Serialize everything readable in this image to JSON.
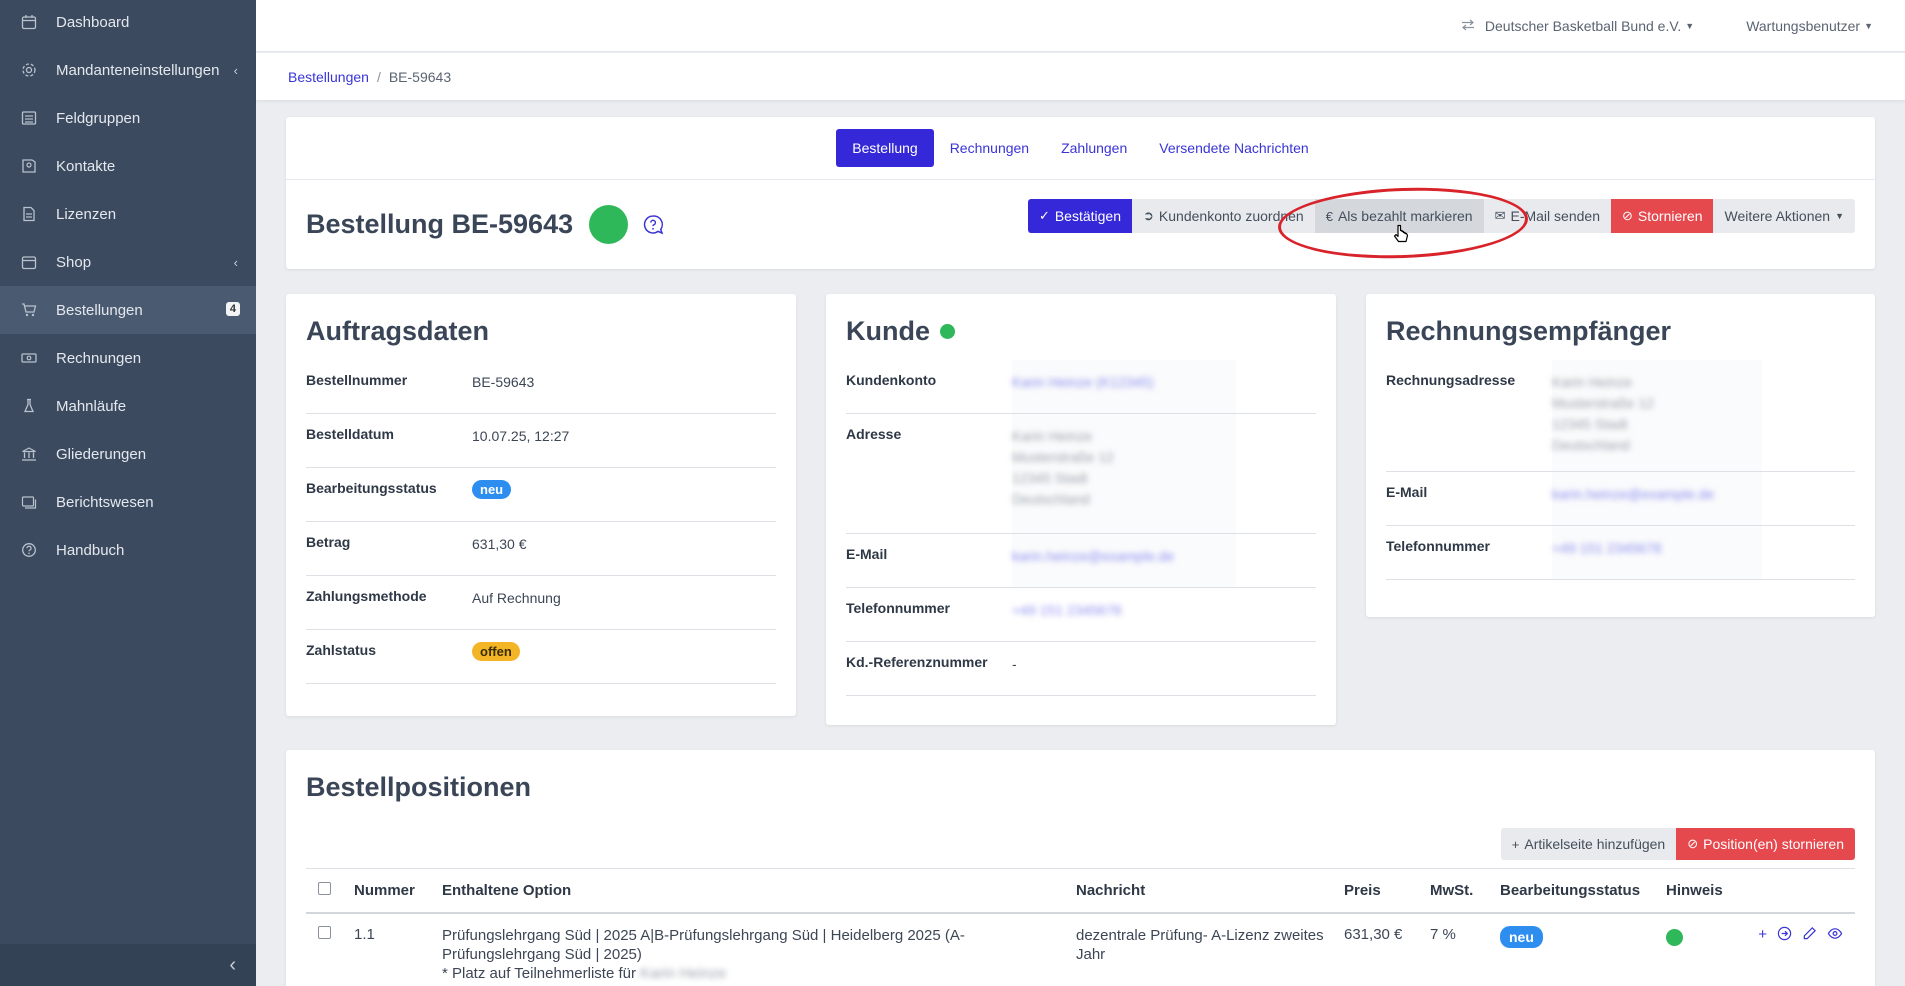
{
  "sidebar": {
    "items": [
      {
        "label": "Dashboard",
        "icon": "calendar-icon"
      },
      {
        "label": "Mandanteneinstellungen",
        "icon": "gear-icon",
        "caret": "‹"
      },
      {
        "label": "Feldgruppen",
        "icon": "list-icon"
      },
      {
        "label": "Kontakte",
        "icon": "book-icon"
      },
      {
        "label": "Lizenzen",
        "icon": "file-icon"
      },
      {
        "label": "Shop",
        "icon": "calendar-icon",
        "caret": "‹"
      },
      {
        "label": "Bestellungen",
        "icon": "cart-icon",
        "badge": "4",
        "active": true
      },
      {
        "label": "Rechnungen",
        "icon": "cash-icon"
      },
      {
        "label": "Mahnläufe",
        "icon": "flask-icon"
      },
      {
        "label": "Gliederungen",
        "icon": "bank-icon"
      },
      {
        "label": "Berichtswesen",
        "icon": "images-icon"
      },
      {
        "label": "Handbuch",
        "icon": "help-icon"
      }
    ],
    "collapse": "‹"
  },
  "topbar": {
    "organization": "Deutscher Basketball Bund e.V.",
    "user": "Wartungsbenutzer"
  },
  "breadcrumb": {
    "parent": "Bestellungen",
    "sep": "/",
    "current": "BE-59643"
  },
  "tabs": [
    "Bestellung",
    "Rechnungen",
    "Zahlungen",
    "Versendete Nachrichten"
  ],
  "order": {
    "title": "Bestellung BE-59643",
    "status_color": "#2fb85a"
  },
  "actions": {
    "confirm": "Bestätigen",
    "assign": "Kundenkonto zuordnen",
    "mark_paid": "Als bezahlt markieren",
    "email": "E-Mail senden",
    "cancel": "Stornieren",
    "more": "Weitere Aktionen"
  },
  "auftragsdaten": {
    "title": "Auftragsdaten",
    "rows": [
      {
        "label": "Bestellnummer",
        "value": "BE-59643"
      },
      {
        "label": "Bestelldatum",
        "value": "10.07.25, 12:27"
      },
      {
        "label": "Bearbeitungsstatus",
        "value": "neu"
      },
      {
        "label": "Betrag",
        "value": "631,30 €"
      },
      {
        "label": "Zahlungsmethode",
        "value": "Auf Rechnung"
      },
      {
        "label": "Zahlstatus",
        "value": "offen"
      }
    ]
  },
  "kunde": {
    "title": "Kunde",
    "rows": [
      {
        "label": "Kundenkonto",
        "value": "Karin Heinze (K12345)"
      },
      {
        "label": "Adresse",
        "lines": [
          "Karin Heinze",
          "Musterstraße 12",
          "12345 Stadt",
          "Deutschland"
        ]
      },
      {
        "label": "E-Mail",
        "value": "karin.heinze@example.de"
      },
      {
        "label": "Telefonnummer",
        "value": "+49 151 2345678"
      },
      {
        "label": "Kd.-Referenznummer",
        "value": "-"
      }
    ]
  },
  "rechnung": {
    "title": "Rechnungsempfänger",
    "rows": [
      {
        "label": "Rechnungsadresse",
        "lines": [
          "Karin Heinze",
          "Musterstraße 12",
          "12345 Stadt",
          "Deutschland"
        ]
      },
      {
        "label": "E-Mail",
        "value": "karin.heinze@example.de"
      },
      {
        "label": "Telefonnummer",
        "value": "+49 151 2345678"
      }
    ]
  },
  "positionen": {
    "title": "Bestellpositionen",
    "add_button": "Artikelseite hinzufügen",
    "cancel_button": "Position(en) stornieren",
    "columns": [
      "Nummer",
      "Enthaltene Option",
      "Nachricht",
      "Preis",
      "MwSt.",
      "Bearbeitungsstatus",
      "Hinweis"
    ],
    "rows": [
      {
        "nummer": "1.1",
        "option": "Prüfungslehrgang Süd | 2025 A|B-Prüfungslehrgang Süd | Heidelberg 2025 (A-Prüfungslehrgang Süd | 2025)",
        "option_note": "* Platz auf Teilnehmerliste für",
        "option_blur": "Karin Heinze",
        "nachricht": "dezentrale Prüfung- A-Lizenz zweites Jahr",
        "preis": "631,30 €",
        "mwst": "7 %",
        "status": "neu"
      }
    ]
  }
}
